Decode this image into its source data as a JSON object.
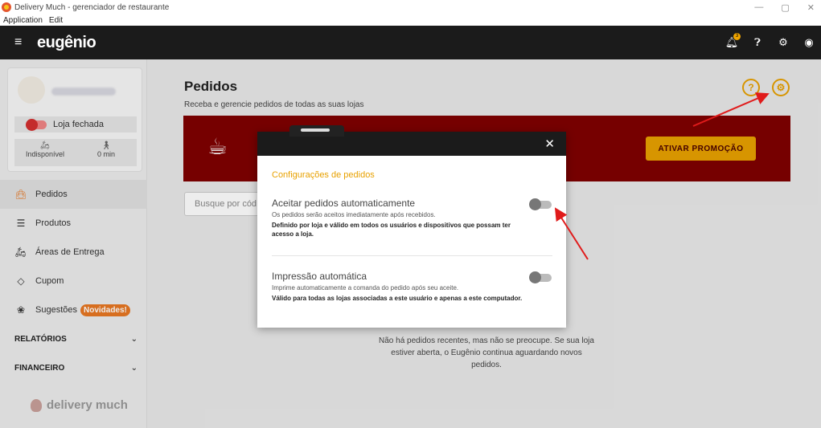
{
  "window": {
    "title": "Delivery Much - gerenciador de restaurante",
    "controls": [
      "—",
      "▢",
      "✕"
    ]
  },
  "menubar": [
    "Application",
    "Edit"
  ],
  "appbar": {
    "logo": "eugênio",
    "notification_count": "3"
  },
  "store": {
    "status_label": "Loja fechada",
    "delivery_status": "Indisponível",
    "time": "0 min"
  },
  "sidebar": {
    "items": [
      {
        "label": "Pedidos",
        "icon": "bag-icon"
      },
      {
        "label": "Produtos",
        "icon": "burger-icon"
      },
      {
        "label": "Áreas de Entrega",
        "icon": "scooter-icon"
      },
      {
        "label": "Cupom",
        "icon": "tag-icon"
      },
      {
        "label": "Sugestões",
        "icon": "percent-icon",
        "badge": "Novidades!"
      }
    ],
    "groups": [
      "RELATÓRIOS",
      "FINANCEIRO"
    ],
    "footer_brand": "delivery much"
  },
  "main": {
    "title": "Pedidos",
    "subtitle": "Receba e gerencie pedidos de todas as suas lojas",
    "promo_button": "ATIVAR PROMOÇÃO",
    "search_placeholder": "Busque por cód",
    "empty_message": "Não há pedidos recentes, mas não se preocupe. Se sua loja estiver aberta, o Eugênio continua aguardando novos pedidos."
  },
  "modal": {
    "title": "Configurações de pedidos",
    "settings": [
      {
        "title": "Aceitar pedidos automaticamente",
        "description": "Os pedidos serão aceitos imediatamente após recebidos.",
        "note": "Definido por loja e válido em todos os usuários e dispositivos que possam ter acesso a loja.",
        "enabled": false
      },
      {
        "title": "Impressão automática",
        "description": "Imprime automaticamente a comanda do pedido após seu aceite.",
        "note": "Válido para todas as lojas associadas a este usuário e apenas a este computador.",
        "enabled": false
      }
    ]
  },
  "colors": {
    "accent": "#e8a100",
    "banner": "#7f0000",
    "appbar": "#1b1b1b",
    "annotation": "#e01b1b"
  }
}
